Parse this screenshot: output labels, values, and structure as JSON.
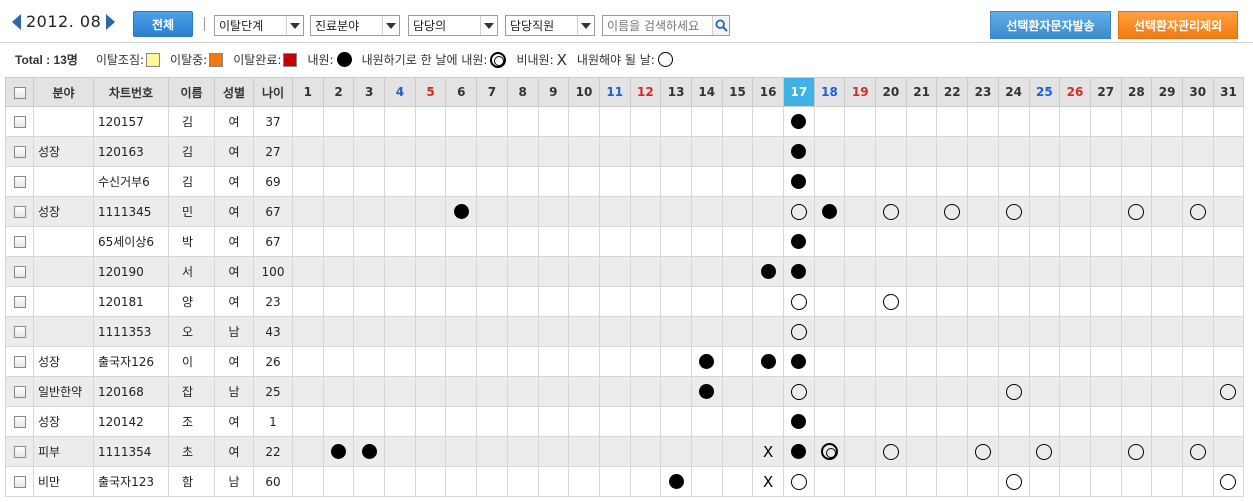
{
  "toolbar": {
    "month": "2012. 08",
    "all_button": "전체",
    "filters": [
      "이탈단계",
      "진료분야",
      "담당의",
      "담당직원"
    ],
    "search_placeholder": "이름을 검색하세요",
    "sms_button": "선택환자문자발송",
    "exclude_button": "선택환자관리제외"
  },
  "legend": {
    "total": "Total : 13명",
    "items": [
      {
        "label": "이탈조짐:",
        "color": "#fff799"
      },
      {
        "label": "이탈중:",
        "color": "#f7760e"
      },
      {
        "label": "이탈완료:",
        "color": "#c40000"
      },
      {
        "label": "내원:"
      },
      {
        "label": "내원하기로 한 날에 내원:"
      },
      {
        "label": "비내원:"
      },
      {
        "label": "내원해야 될 날:"
      }
    ]
  },
  "table": {
    "headers": [
      "분야",
      "차트번호",
      "이름",
      "성별",
      "나이"
    ],
    "days": [
      "1",
      "2",
      "3",
      "4",
      "5",
      "6",
      "7",
      "8",
      "9",
      "10",
      "11",
      "12",
      "13",
      "14",
      "15",
      "16",
      "17",
      "18",
      "19",
      "20",
      "21",
      "22",
      "23",
      "24",
      "25",
      "26",
      "27",
      "28",
      "29",
      "30",
      "31"
    ],
    "blue_days": [
      4,
      11,
      18,
      25
    ],
    "red_days": [
      5,
      12,
      19,
      26
    ],
    "today": 17,
    "colors": {
      "header_bg": "#e3e3e3",
      "today_bg": "#3eb2e6",
      "blue": "#1f5fd0",
      "red": "#d42a2a",
      "alt_row": "#ececec"
    },
    "symbol_legend": {
      "V": "visited",
      "K": "visited on scheduled day",
      "X": "not visited",
      "O": "scheduled visit day"
    },
    "rows": [
      {
        "field": "",
        "chart": "120157",
        "name": "김",
        "gender": "여",
        "age": "37",
        "marks": {
          "17": "V"
        }
      },
      {
        "field": "성장",
        "chart": "120163",
        "name": "김",
        "gender": "여",
        "age": "27",
        "marks": {
          "17": "V"
        }
      },
      {
        "field": "",
        "chart": "수신거부6",
        "name": "김",
        "gender": "여",
        "age": "69",
        "marks": {
          "17": "V"
        }
      },
      {
        "field": "성장",
        "chart": "1111345",
        "name": "민",
        "gender": "여",
        "age": "67",
        "marks": {
          "6": "V",
          "17": "O",
          "18": "V",
          "20": "O",
          "22": "O",
          "24": "O",
          "28": "O",
          "30": "O"
        }
      },
      {
        "field": "",
        "chart": "65세이상6",
        "name": "박",
        "gender": "여",
        "age": "67",
        "marks": {
          "17": "V"
        }
      },
      {
        "field": "",
        "chart": "120190",
        "name": "서",
        "gender": "여",
        "age": "100",
        "marks": {
          "16": "V",
          "17": "V"
        }
      },
      {
        "field": "",
        "chart": "120181",
        "name": "양",
        "gender": "여",
        "age": "23",
        "marks": {
          "17": "O",
          "20": "O"
        }
      },
      {
        "field": "",
        "chart": "1111353",
        "name": "오",
        "gender": "남",
        "age": "43",
        "marks": {
          "17": "O"
        }
      },
      {
        "field": "성장",
        "chart": "출국자126",
        "name": "이",
        "gender": "여",
        "age": "26",
        "marks": {
          "14": "V",
          "16": "V",
          "17": "V"
        }
      },
      {
        "field": "일반한약",
        "chart": "120168",
        "name": "잡",
        "gender": "남",
        "age": "25",
        "marks": {
          "14": "V",
          "17": "O",
          "24": "O",
          "31": "O"
        }
      },
      {
        "field": "성장",
        "chart": "120142",
        "name": "조",
        "gender": "여",
        "age": "1",
        "marks": {
          "17": "V"
        }
      },
      {
        "field": "피부",
        "chart": "1111354",
        "name": "초",
        "gender": "여",
        "age": "22",
        "marks": {
          "2": "V",
          "3": "V",
          "16": "X",
          "17": "V",
          "18": "K",
          "20": "O",
          "23": "O",
          "25": "O",
          "28": "O",
          "30": "O"
        }
      },
      {
        "field": "비만",
        "chart": "출국자123",
        "name": "함",
        "gender": "남",
        "age": "60",
        "marks": {
          "13": "V",
          "16": "X",
          "17": "O",
          "24": "O",
          "31": "O"
        }
      }
    ]
  }
}
